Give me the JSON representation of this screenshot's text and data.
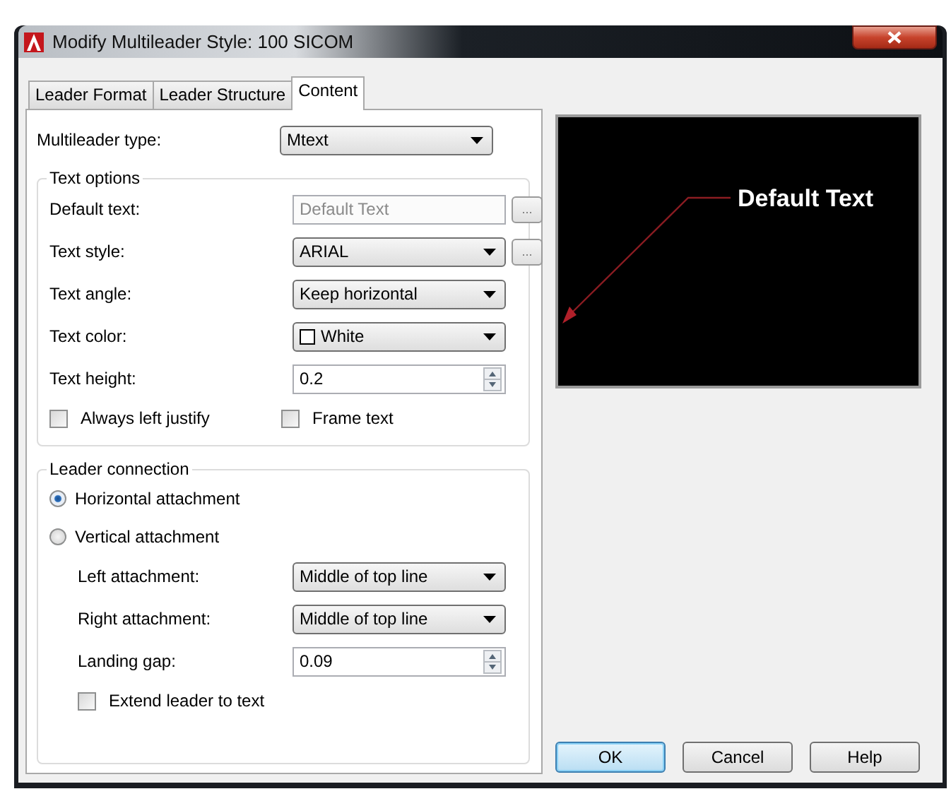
{
  "window": {
    "title": "Modify Multileader Style: 100 SICOM"
  },
  "tabs": [
    {
      "label": "Leader Format",
      "selected": false
    },
    {
      "label": "Leader Structure",
      "selected": false
    },
    {
      "label": "Content",
      "selected": true
    }
  ],
  "multileader_type": {
    "label": "Multileader type:",
    "value": "Mtext"
  },
  "text_options": {
    "title": "Text options",
    "rows": [
      {
        "kind": "field",
        "label": "Default text:",
        "value": "Default Text",
        "disabled": true,
        "browse": "..."
      },
      {
        "kind": "dropdown",
        "label": "Text style:",
        "value": "ARIAL",
        "browse": "..."
      },
      {
        "kind": "dropdown",
        "label": "Text angle:",
        "value": "Keep horizontal"
      },
      {
        "kind": "color",
        "label": "Text color:",
        "value": "White",
        "color": "#ffffff"
      },
      {
        "kind": "spinner",
        "label": "Text height:",
        "value": "0.2"
      }
    ],
    "checkboxes": [
      {
        "label": "Always left justify",
        "checked": false
      },
      {
        "label": "Frame text",
        "checked": false
      }
    ]
  },
  "leader_connection": {
    "title": "Leader connection",
    "radios": [
      {
        "label": "Horizontal attachment",
        "selected": true
      },
      {
        "label": "Vertical attachment",
        "selected": false
      }
    ],
    "rows": [
      {
        "kind": "dropdown",
        "label": "Left attachment:",
        "value": "Middle of top line"
      },
      {
        "kind": "dropdown",
        "label": "Right attachment:",
        "value": "Middle of top line"
      },
      {
        "kind": "spinner",
        "label": "Landing gap:",
        "value": "0.09"
      }
    ],
    "checkboxes": [
      {
        "label": "Extend leader to text",
        "checked": false
      }
    ]
  },
  "preview": {
    "text": "Default Text"
  },
  "buttons": [
    {
      "label": "OK",
      "default": true
    },
    {
      "label": "Cancel",
      "default": false
    },
    {
      "label": "Help",
      "default": false
    }
  ]
}
